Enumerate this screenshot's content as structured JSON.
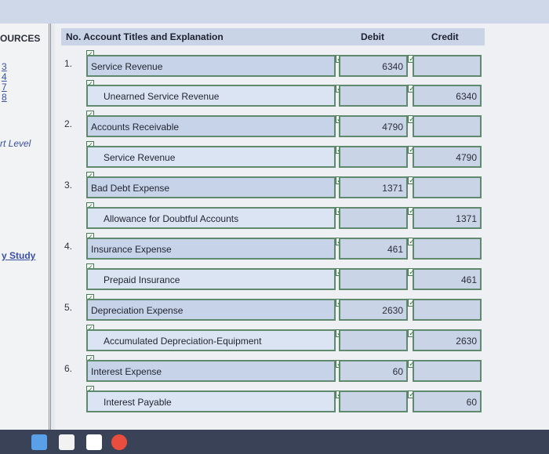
{
  "sidebar": {
    "title": "OURCES",
    "links": [
      "3",
      "4",
      "7",
      "8"
    ],
    "part_level": "rt Level",
    "study": "y Study"
  },
  "table": {
    "col_titles": "No. Account Titles and Explanation",
    "col_debit": "Debit",
    "col_credit": "Credit",
    "rows": [
      {
        "num": "1.",
        "account": "Service Revenue",
        "debit": "6340",
        "credit": ""
      },
      {
        "num": "",
        "account": "Unearned Service Revenue",
        "debit": "",
        "credit": "6340"
      },
      {
        "num": "2.",
        "account": "Accounts Receivable",
        "debit": "4790",
        "credit": ""
      },
      {
        "num": "",
        "account": "Service Revenue",
        "debit": "",
        "credit": "4790"
      },
      {
        "num": "3.",
        "account": "Bad Debt Expense",
        "debit": "1371",
        "credit": ""
      },
      {
        "num": "",
        "account": "Allowance for Doubtful Accounts",
        "debit": "",
        "credit": "1371"
      },
      {
        "num": "4.",
        "account": "Insurance Expense",
        "debit": "461",
        "credit": ""
      },
      {
        "num": "",
        "account": "Prepaid Insurance",
        "debit": "",
        "credit": "461"
      },
      {
        "num": "5.",
        "account": "Depreciation Expense",
        "debit": "2630",
        "credit": ""
      },
      {
        "num": "",
        "account": "Accumulated Depreciation-Equipment",
        "debit": "",
        "credit": "2630"
      },
      {
        "num": "6.",
        "account": "Interest Expense",
        "debit": "60",
        "credit": ""
      },
      {
        "num": "",
        "account": "Interest Payable",
        "debit": "",
        "credit": "60"
      }
    ]
  },
  "checkmark": "✓"
}
